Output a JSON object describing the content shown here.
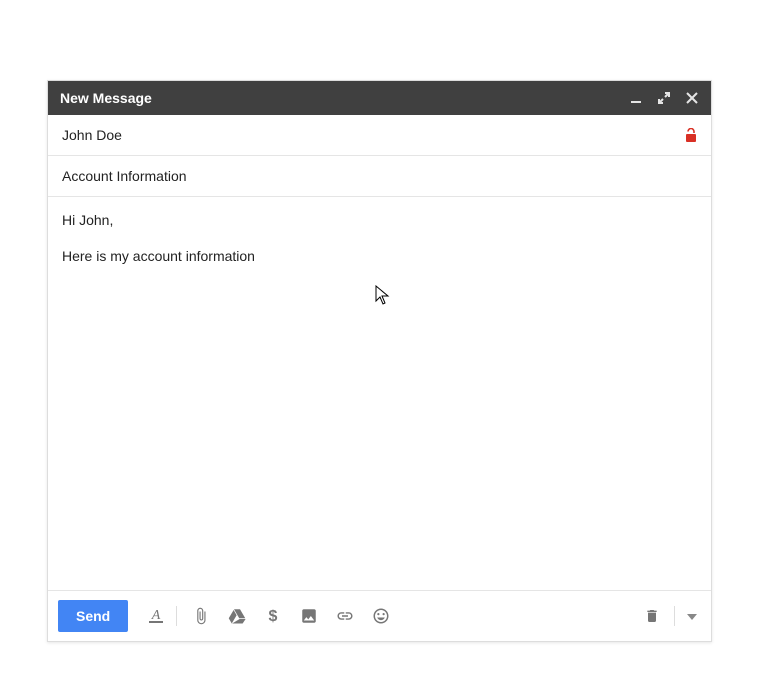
{
  "compose": {
    "title": "New Message",
    "to": "John Doe",
    "subject": "Account Information",
    "body_line1": "Hi John,",
    "body_line2": "Here is my account information",
    "send_label": "Send"
  },
  "colors": {
    "titlebar_bg": "#404040",
    "send_bg": "#4285f4",
    "lock": "#d93025",
    "icon_gray": "#767676"
  }
}
